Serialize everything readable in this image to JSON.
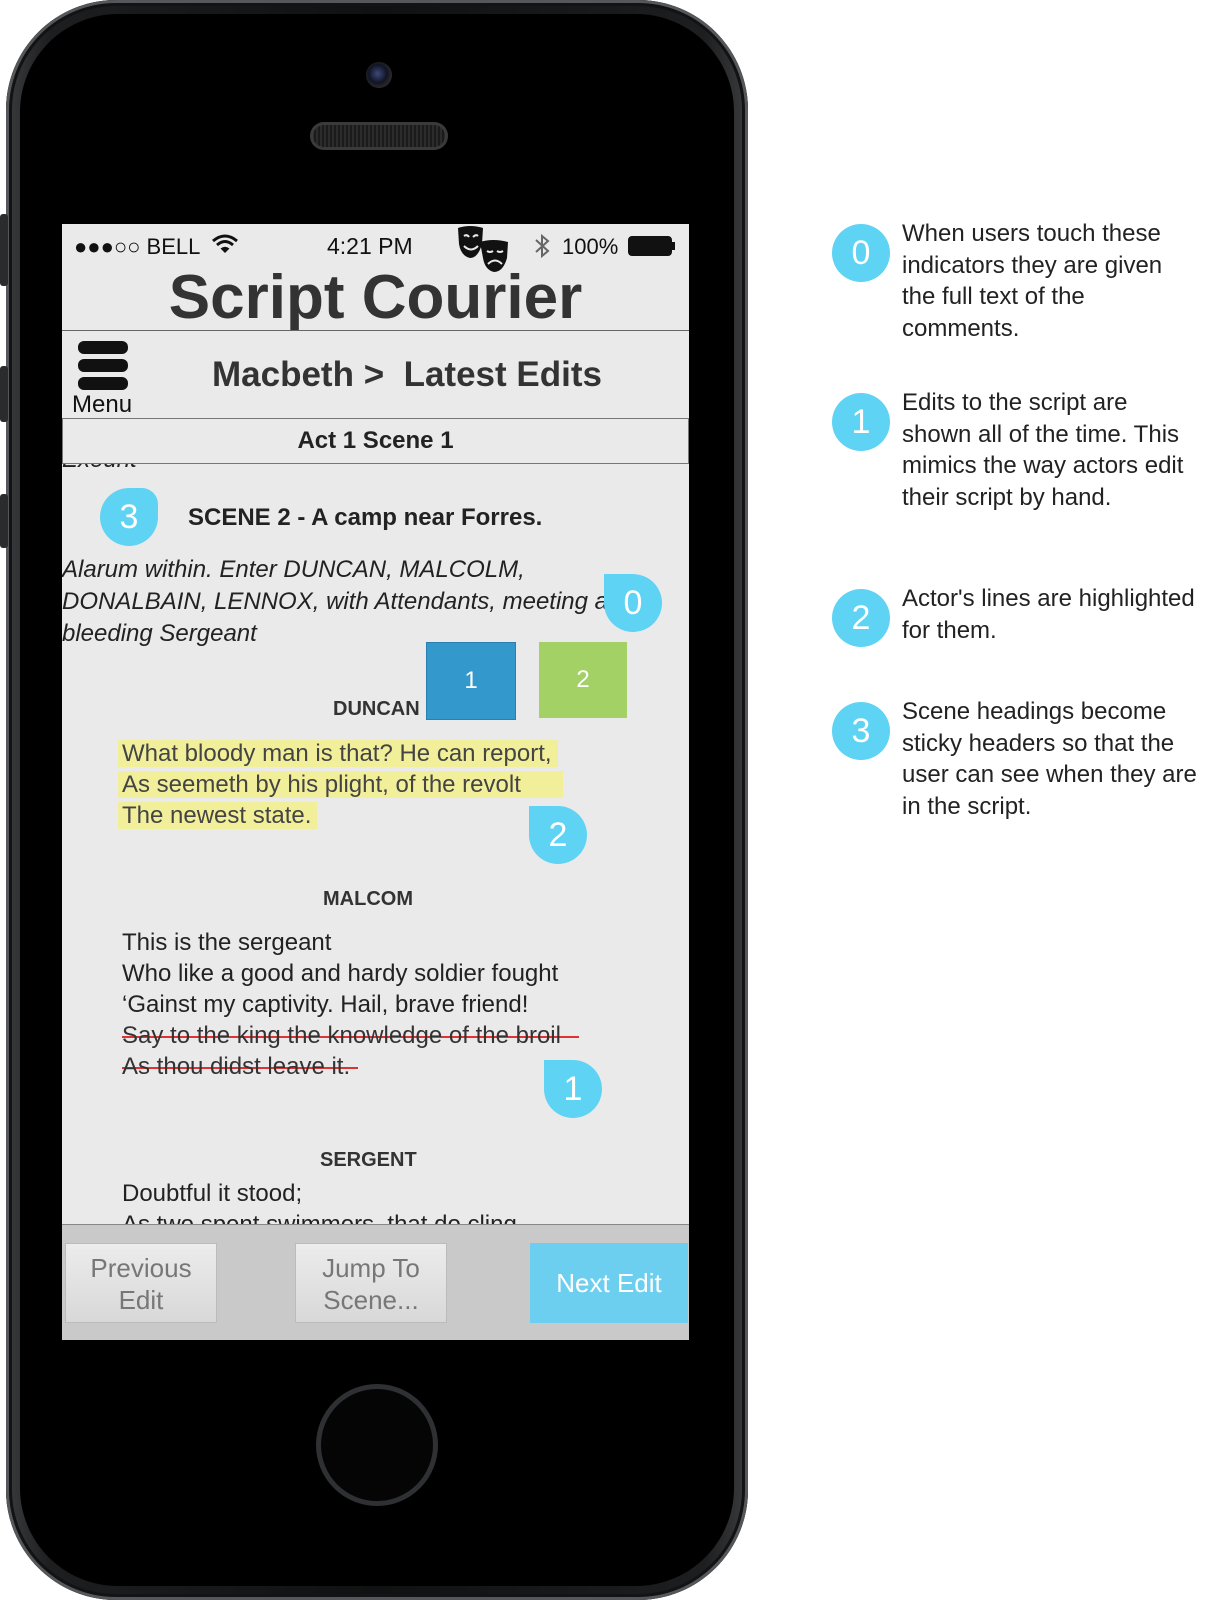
{
  "status_bar": {
    "carrier": "●●●○○ BELL",
    "time": "4:21 PM",
    "battery": "100%"
  },
  "app": {
    "title": "Script Courier"
  },
  "nav": {
    "menu_label": "Menu",
    "breadcrumb": "Macbeth >  Latest Edits"
  },
  "sticky_header": "Act 1 Scene 1",
  "script": {
    "cut_line": "Exeunt",
    "scene_heading": "SCENE 2 - A camp near Forres.",
    "stage_direction": "Alarum within. Enter DUNCAN, MALCOLM, DONALBAIN, LENNOX, with Attendants, meeting a bleeding Sergeant",
    "speeches": [
      {
        "character": "DUNCAN",
        "lines": [
          "What bloody man is that? He can report,",
          "As seemeth by his plight, of the revolt",
          "The newest state."
        ]
      },
      {
        "character": "MALCOM",
        "lines": [
          "This is the sergeant",
          "Who like a good and hardy soldier fought",
          "‘Gainst my captivity. Hail, brave friend!",
          "Say to the king the knowledge of the broil",
          "As thou didst leave it."
        ]
      },
      {
        "character": "SERGENT",
        "lines": [
          "Doubtful it stood;",
          "As two spent swimmers, that do cling"
        ]
      }
    ]
  },
  "tag_boxes": [
    {
      "label": "1",
      "color": "#3399cc"
    },
    {
      "label": "2",
      "color": "#a3d165"
    }
  ],
  "indicators": {
    "comments": "0",
    "edits": "1",
    "highlight": "2",
    "heading": "3"
  },
  "bottom_bar": {
    "previous": "Previous Edit",
    "jump": "Jump To Scene...",
    "next": "Next Edit"
  },
  "annotations": [
    {
      "number": "0",
      "text": "When users touch these indicators they are given the full text of the comments."
    },
    {
      "number": "1",
      "text": "Edits to the script are shown all of the time. This mimics the way actors edit their script by hand."
    },
    {
      "number": "2",
      "text": "Actor's lines are highlighted for them."
    },
    {
      "number": "3",
      "text": "Scene headings become sticky headers so that the user can see when they are in the script."
    }
  ],
  "colors": {
    "accent": "#5fd3f3",
    "highlight": "#f2ef9b",
    "strike": "#dd3333"
  }
}
